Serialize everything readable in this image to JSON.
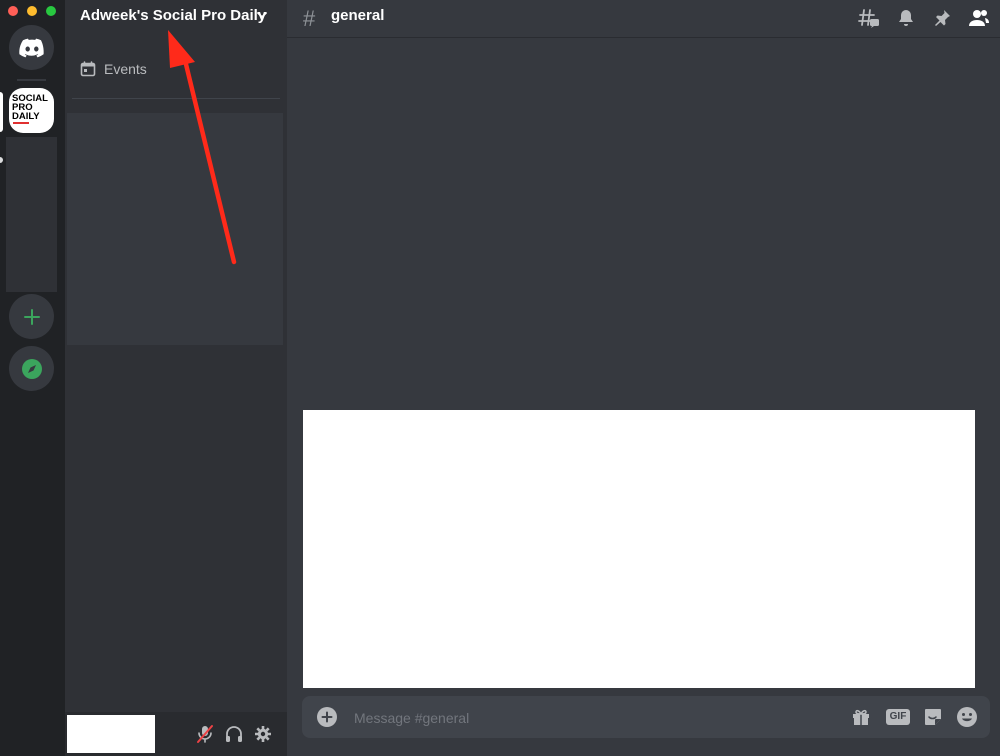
{
  "window": {
    "traffic_colors": [
      "#ff5f57",
      "#febc2e",
      "#28c840"
    ]
  },
  "rail": {
    "icons": {
      "home": "discord-logo-icon",
      "add": "plus-icon",
      "explore": "compass-icon"
    },
    "server_icon_text": [
      "SOCIAL",
      "PRO",
      "DAILY"
    ]
  },
  "sidebar": {
    "server_name": "Adweek's Social Pro Daily",
    "items": [
      {
        "label": "Events",
        "icon": "calendar-icon"
      }
    ],
    "user_controls": [
      "mute-mic-icon",
      "headphones-icon",
      "settings-gear-icon"
    ]
  },
  "header": {
    "channel_prefix": "#",
    "channel_name": "general",
    "icons": [
      "threads-icon",
      "notification-bell-icon",
      "pin-icon",
      "member-list-icon"
    ]
  },
  "composer": {
    "placeholder": "Message #general",
    "icons": [
      "gift-icon",
      "gif-icon",
      "sticker-icon",
      "emoji-icon"
    ],
    "gif_label": "GIF"
  },
  "colors": {
    "accent_green": "#3ba55d",
    "annotation_arrow": "#ff2a1a",
    "muted_red": "#ed4245"
  }
}
